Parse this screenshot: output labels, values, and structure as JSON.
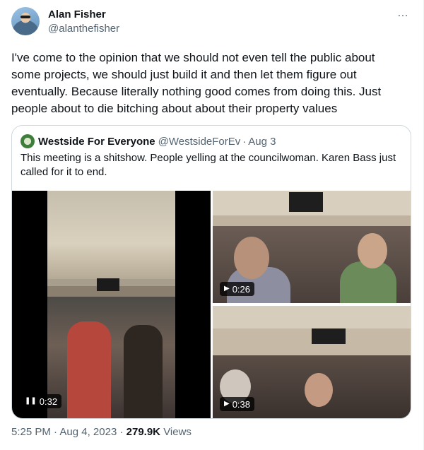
{
  "author": {
    "name": "Alan Fisher",
    "handle": "@alanthefisher"
  },
  "more_icon": "…",
  "tweet_text": "I've come to the opinion that we should not even tell the public about some projects, we should just build it and then let them figure out eventually. Because literally nothing good comes from doing this. Just people about to die bitching about about their property values",
  "quote": {
    "name": "Westside For Everyone",
    "handle": "@WestsideForEv",
    "separator": "·",
    "date": "Aug 3",
    "text": "This meeting is a shitshow. People yelling at the councilwoman. Karen Bass just called for it to end.",
    "videos": [
      {
        "state_icon": "pause-icon",
        "glyph": "❚❚",
        "duration": "0:32"
      },
      {
        "state_icon": "play-icon",
        "glyph": "▶",
        "duration": "0:26"
      },
      {
        "state_icon": "play-icon",
        "glyph": "▶",
        "duration": "0:38"
      }
    ]
  },
  "meta": {
    "time": "5:25 PM",
    "separator": "·",
    "date": "Aug 4, 2023",
    "views_count": "279.9K",
    "views_label": "Views"
  }
}
